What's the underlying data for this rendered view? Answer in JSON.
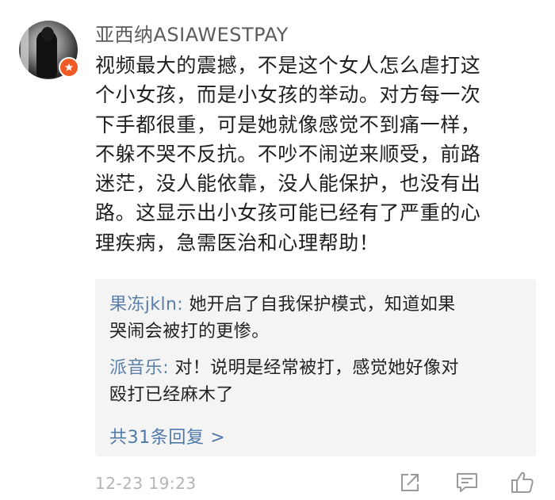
{
  "post": {
    "username": "亚西纳ASIAWESTPAY",
    "avatar_icon": "user-avatar",
    "badge_icon": "verified-badge",
    "body": "视频最大的震撼，不是这个女人怎么虐打这\n个小女孩，而是小女孩的举动。对方每一次\n下手都很重，可是她就像感觉不到痛一样，\n不躲不哭不反抗。不吵不闹逆来顺受，前路\n迷茫，没人能依靠，没人能保护，也没有出\n路。这显示出小女孩可能已经有了严重的心\n理疾病，急需医治和心理帮助！",
    "timestamp": "12-23 19:23"
  },
  "replies": [
    {
      "author": "果冻jkln:",
      "text": " 她开启了自我保护模式，知道如果\n哭闹会被打的更惨。"
    },
    {
      "author": "派音乐:",
      "text": " 对！说明是经常被打，感觉她好像对\n殴打已经麻木了"
    }
  ],
  "more_replies_label": "共31条回复 >",
  "actions": {
    "share_icon": "share-icon",
    "comment_icon": "comment-icon",
    "like_icon": "thumbs-up-icon"
  },
  "colors": {
    "author_link": "#5b7fa8",
    "more_link": "#4f79aa",
    "badge": "#f15a24",
    "reply_bg": "#f4f4f4",
    "timestamp": "#b5b5b5"
  }
}
